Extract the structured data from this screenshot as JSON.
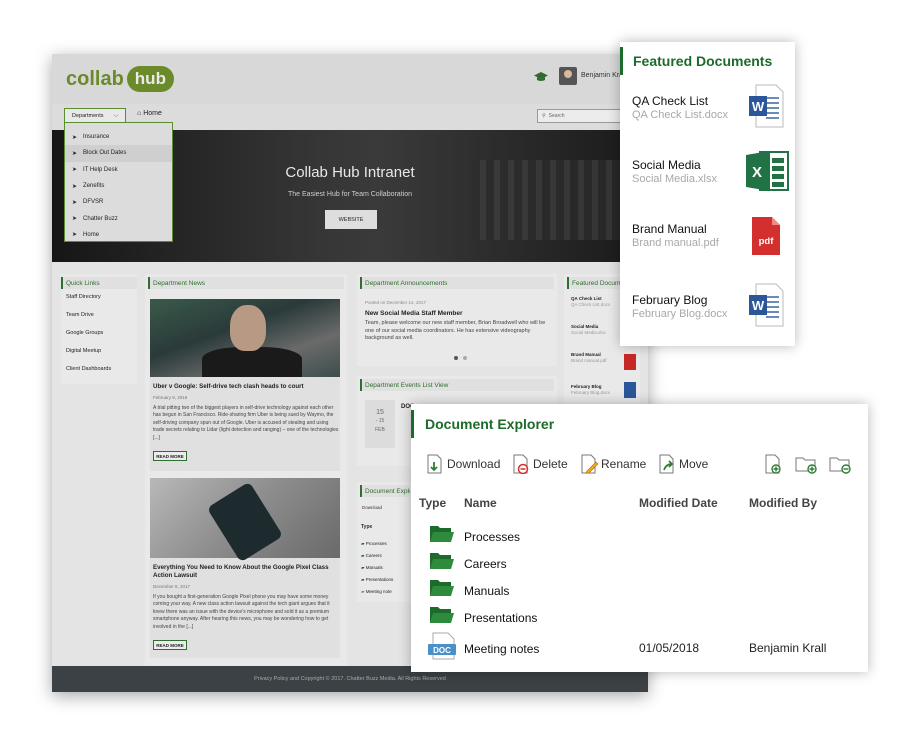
{
  "intranet": {
    "logo": {
      "part1": "collab",
      "part2": "hub"
    },
    "user_name": "Benjamin Kra",
    "nav": {
      "departments": "Departments",
      "home": "Home",
      "search_placeholder": "Search"
    },
    "dropdown": [
      "Insurance",
      "Block Out Dates",
      "IT Help Desk",
      "Zenefits",
      "DFVSR",
      "Chatter Buzz",
      "Home"
    ],
    "hero": {
      "title": "Collab Hub Intranet",
      "subtitle": "The Easiest Hub for Team Collaboration",
      "button": "WEBSITE"
    },
    "quick_links": {
      "title": "Quick Links",
      "items": [
        "Staff Directory",
        "Team Drive",
        "Google Groups",
        "Digital Meetup",
        "Client Dashboards"
      ]
    },
    "department_news": {
      "title": "Department News",
      "articles": [
        {
          "title": "Uber v Google: Self-drive tech clash heads to court",
          "date": "February 8, 2018",
          "body": "A trial pitting two of the biggest players in self-drive technology against each other has begun in San Francisco. Ride-sharing firm Uber is being sued by Waymo, the self-driving company spun out of Google. Uber is accused of stealing and using trade secrets relating to Lidar (light detection and ranging) – one of the technologies [...]",
          "button": "READ MORE"
        },
        {
          "title": "Everything You Need to Know About the Google Pixel Class Action Lawsuit",
          "date": "December 8, 2017",
          "body": "If you bought a first-generation Google Pixel phone you may have some money coming your way. A new class action lawsuit against the tech giant argues that it knew there was an issue with the device's microphone and sold it as a premium smartphone anyway. After hearing this news, you may be wondering how to get involved in the [...]",
          "button": "READ MORE"
        }
      ]
    },
    "announcements": {
      "title": "Department Announcements",
      "posted": "Posted on December 14, 2017",
      "item_title": "New Social Media Staff Member",
      "body": "Team, please welcome our new staff member, Brian Broadwell who will be one of our social media coordinators. He has extensive videography background as well."
    },
    "events": {
      "title": "Department Events List View",
      "date_num": "15",
      "date_range": "- 15",
      "date_day": "FEB",
      "event_title": "DOC"
    },
    "doc_explorer_small": {
      "title": "Document Explorer",
      "download": "Download",
      "type": "Type",
      "folders": [
        "Processes",
        "Careers",
        "Manuals",
        "Presentations"
      ],
      "file": "Meeting note"
    },
    "featured_small": {
      "title": "Featured Documents",
      "items": [
        {
          "name": "QA Check List",
          "file": "QA Check List.docx"
        },
        {
          "name": "Social Media",
          "file": "Social Media.xlsx"
        },
        {
          "name": "Brand Manual",
          "file": "Brand manual.pdf"
        },
        {
          "name": "February Blog",
          "file": "February Blog.docx"
        }
      ]
    },
    "footer": "Privacy Policy and Copyright © 2017. Chatter Buzz Media. All Rights Reserved"
  },
  "featured": {
    "title": "Featured Documents",
    "items": [
      {
        "name": "QA Check List",
        "file": "QA Check List.docx",
        "icon": "word-icon"
      },
      {
        "name": "Social Media",
        "file": "Social Media.xlsx",
        "icon": "excel-icon"
      },
      {
        "name": "Brand Manual",
        "file": "Brand manual.pdf",
        "icon": "pdf-icon"
      },
      {
        "name": "February Blog",
        "file": "February Blog.docx",
        "icon": "word-icon"
      }
    ]
  },
  "explorer": {
    "title": "Document Explorer",
    "toolbar": {
      "download": "Download",
      "delete": "Delete",
      "rename": "Rename",
      "move": "Move"
    },
    "columns": {
      "type": "Type",
      "name": "Name",
      "modified_date": "Modified Date",
      "modified_by": "Modified By"
    },
    "rows": [
      {
        "name": "Processes",
        "kind": "folder"
      },
      {
        "name": "Careers",
        "kind": "folder"
      },
      {
        "name": "Manuals",
        "kind": "folder"
      },
      {
        "name": "Presentations",
        "kind": "folder"
      },
      {
        "name": "Meeting notes",
        "kind": "doc",
        "modified_date": "01/05/2018",
        "modified_by": "Benjamin Krall"
      }
    ]
  },
  "colors": {
    "brand_green": "#1d6b2a",
    "logo_green": "#6b8a2a",
    "word_blue": "#2b579a",
    "excel_green": "#217346",
    "pdf_red": "#d32f2f"
  }
}
